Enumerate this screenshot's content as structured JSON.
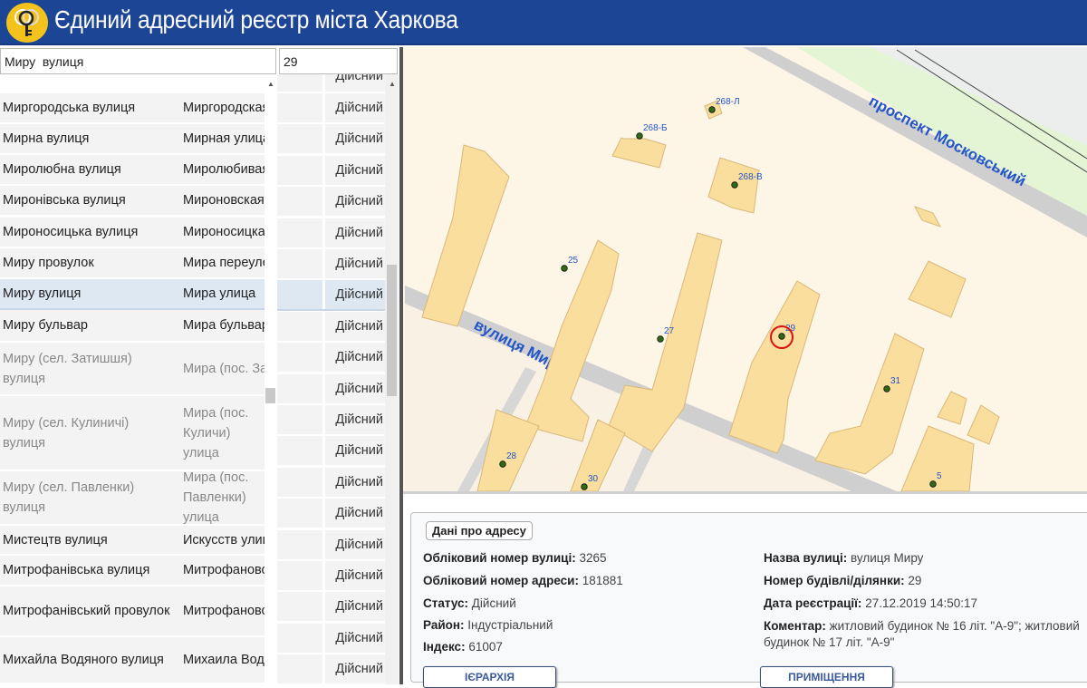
{
  "header": {
    "title": "Єдиний адресний реєстр міста Харкова",
    "logo": "keys-logo"
  },
  "search": {
    "street_value": "Миру  вулиця",
    "house_value": "29"
  },
  "table": {
    "top_partial_status": "Дійсний",
    "rows": [
      {
        "ua": "Миргородська вулиця",
        "ru": "Миргородская",
        "gray": false
      },
      {
        "ua": "Мирна вулиця",
        "ru": "Мирная улица",
        "gray": false
      },
      {
        "ua": "Миролюбна вулиця",
        "ru": "Миролюбивая",
        "gray": false
      },
      {
        "ua": "Миронівська вулиця",
        "ru": "Мироновская",
        "gray": false
      },
      {
        "ua": "Мироносицька вулиця",
        "ru": "Мироносицкая",
        "gray": false
      },
      {
        "ua": "Миру провулок",
        "ru": "Мира переулок",
        "gray": false
      },
      {
        "ua": "Миру вулиця",
        "ru": "Мира улица",
        "gray": false,
        "selected": true
      },
      {
        "ua": "Миру бульвар",
        "ru": "Мира бульвар",
        "gray": false
      },
      {
        "ua": "Миру (сел. Затишшя) вулиця",
        "ru": "Мира (пос. Затишье)",
        "gray": true
      },
      {
        "ua": "Миру (сел. Кулиничі) вулиця",
        "ru": "Мира (пос. Куличи) улица",
        "gray": true
      },
      {
        "ua": "Миру (сел. Павленки) вулиця",
        "ru": "Мира (пос. Павленки) улица",
        "gray": true
      },
      {
        "ua": "Мистецтв вулиця",
        "ru": "Искусств улица",
        "gray": false
      },
      {
        "ua": "Митрофанівська вулиця",
        "ru": "Митрофановская",
        "gray": false
      },
      {
        "ua": "Митрофанівський провулок",
        "ru": "Митрофановский",
        "gray": false
      },
      {
        "ua": "Михайла Водяного вулиця",
        "ru": "Михаила Водяного",
        "gray": false
      }
    ],
    "statuses": [
      "Дійсний",
      "Дійсний",
      "Дійсний",
      "Дійсний",
      "Дійсний",
      "Дійсний",
      "Дійсний",
      "Дійсний",
      "Дійсний",
      "Дійсний",
      "Дійсний",
      "Дійсний",
      "Дійсний",
      "Дійсний",
      "Дійсний",
      "Дійсний",
      "Дійсний",
      "Дійсний",
      "Дійсний"
    ]
  },
  "map": {
    "streets": [
      "проспект Московський",
      "вулиця Миру"
    ],
    "buildings": [
      "268-Л",
      "268-Б",
      "268-В",
      "25",
      "27",
      "29",
      "31",
      "28",
      "30",
      "5"
    ],
    "selected_building": "29"
  },
  "details": {
    "legend": "Дані про адресу",
    "street_id_label": "Обліковий номер вулиці:",
    "street_id": "3265",
    "address_id_label": "Обліковий номер адреси:",
    "address_id": "181881",
    "status_label": "Статус:",
    "status": "Дійсний",
    "district_label": "Район:",
    "district": "Індустріальний",
    "index_label": "Індекс:",
    "index": "61007",
    "street_name_label": "Назва вулиці:",
    "street_name": "вулиця Миру",
    "building_label": "Номер будівлі/ділянки:",
    "building": "29",
    "reg_date_label": "Дата реєстрації:",
    "reg_date": "27.12.2019 14:50:17",
    "comment_label": "Коментар:",
    "comment": "житловий будинок № 16 літ. \"А-9\"; житловий будинок № 17 літ. \"А-9\"",
    "hierarchy_button": "ІЄРАРХІЯ",
    "premises_button": "ПРИМІЩЕННЯ"
  }
}
